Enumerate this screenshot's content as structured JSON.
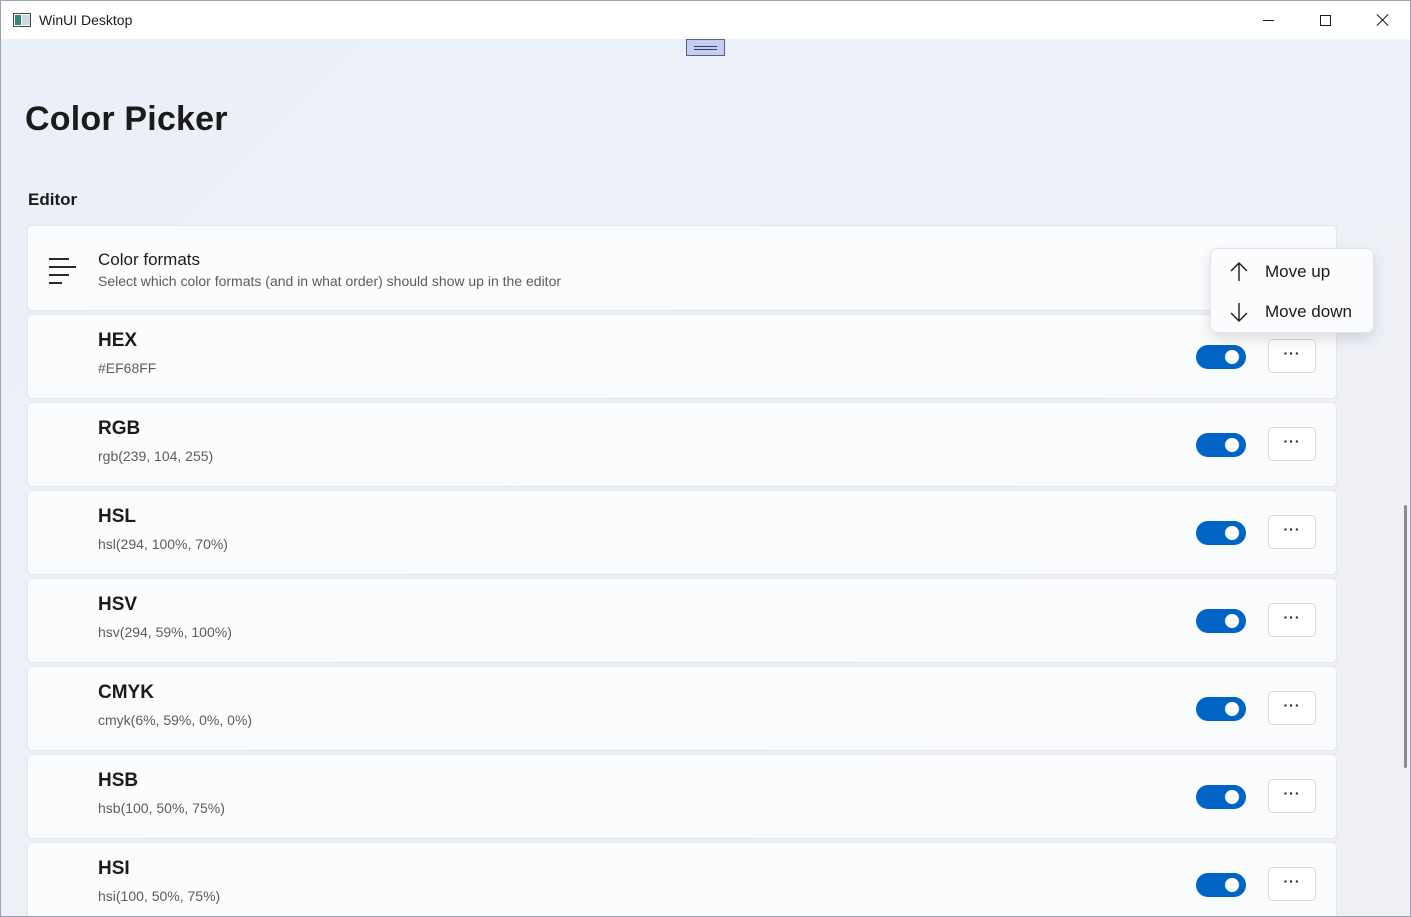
{
  "window": {
    "title": "WinUI Desktop",
    "accent_color": "#0063c6"
  },
  "page": {
    "title": "Color Picker",
    "section": "Editor"
  },
  "header_card": {
    "icon": "list-icon",
    "title": "Color formats",
    "description": "Select which color formats (and in what order) should show up in the editor"
  },
  "formats": [
    {
      "name": "HEX",
      "example": "#EF68FF",
      "enabled": true
    },
    {
      "name": "RGB",
      "example": "rgb(239, 104, 255)",
      "enabled": true
    },
    {
      "name": "HSL",
      "example": "hsl(294, 100%, 70%)",
      "enabled": true
    },
    {
      "name": "HSV",
      "example": "hsv(294, 59%, 100%)",
      "enabled": true
    },
    {
      "name": "CMYK",
      "example": "cmyk(6%, 59%, 0%, 0%)",
      "enabled": true
    },
    {
      "name": "HSB",
      "example": "hsb(100, 50%, 75%)",
      "enabled": true
    },
    {
      "name": "HSI",
      "example": "hsi(100, 50%, 75%)",
      "enabled": true
    }
  ],
  "more_button_label": "···",
  "context_menu": {
    "items": [
      {
        "label": "Move up",
        "icon": "arrow-up-icon"
      },
      {
        "label": "Move down",
        "icon": "arrow-down-icon"
      }
    ]
  }
}
